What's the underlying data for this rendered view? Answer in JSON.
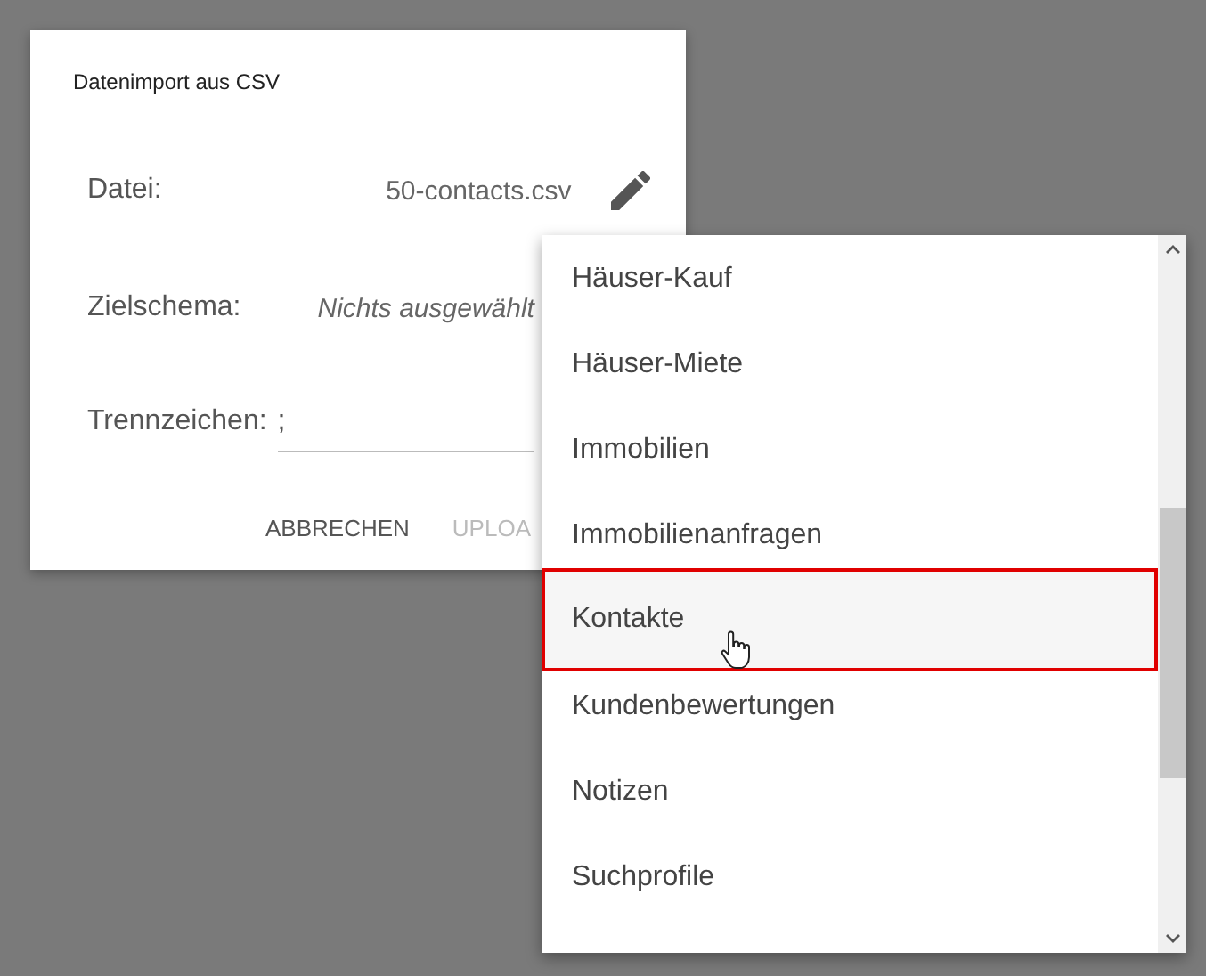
{
  "dialog": {
    "title": "Datenimport aus CSV",
    "fields": [
      {
        "kind": "file",
        "label": "Datei:",
        "value": "50-contacts.csv"
      },
      {
        "kind": "select",
        "label": "Zielschema:",
        "placeholder": "Nichts ausgewählt"
      },
      {
        "kind": "text",
        "label": "Trennzeichen:",
        "value": ";"
      }
    ],
    "buttons": [
      {
        "label": "ABBRECHEN",
        "disabled": false
      },
      {
        "label": "UPLOA",
        "disabled": true
      }
    ]
  },
  "dropdown": {
    "items": [
      {
        "label": "Häuser-Kauf",
        "selected": false
      },
      {
        "label": "Häuser-Miete",
        "selected": false
      },
      {
        "label": "Immobilien",
        "selected": false
      },
      {
        "label": "Immobilienanfragen",
        "selected": false
      },
      {
        "label": "Kontakte",
        "selected": true
      },
      {
        "label": "Kundenbewertungen",
        "selected": false
      },
      {
        "label": "Notizen",
        "selected": false
      },
      {
        "label": "Suchprofile",
        "selected": false
      }
    ]
  }
}
